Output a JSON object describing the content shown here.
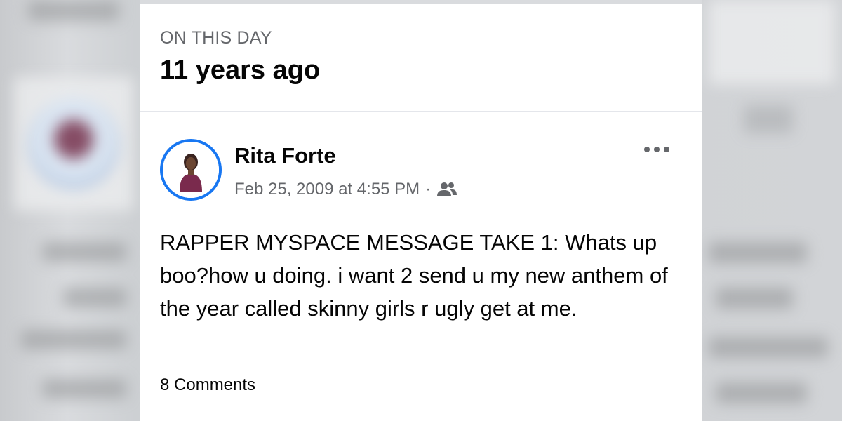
{
  "memory": {
    "eyebrow": "ON THIS DAY",
    "headline": "11 years ago"
  },
  "post": {
    "author": "Rita Forte",
    "timestamp": "Feb 25, 2009 at 4:55 PM",
    "separator": "·",
    "audience_icon": "friends-icon",
    "more_icon": "more-options-icon",
    "body": "RAPPER MYSPACE MESSAGE TAKE 1: Whats up boo?how u doing. i want 2 send u my new anthem of the year called skinny girls r ugly get at me.",
    "comments_label": "8 Comments"
  },
  "colors": {
    "accent": "#1877f2",
    "text_primary": "#050505",
    "text_secondary": "#65676b",
    "divider": "#e4e6eb"
  }
}
